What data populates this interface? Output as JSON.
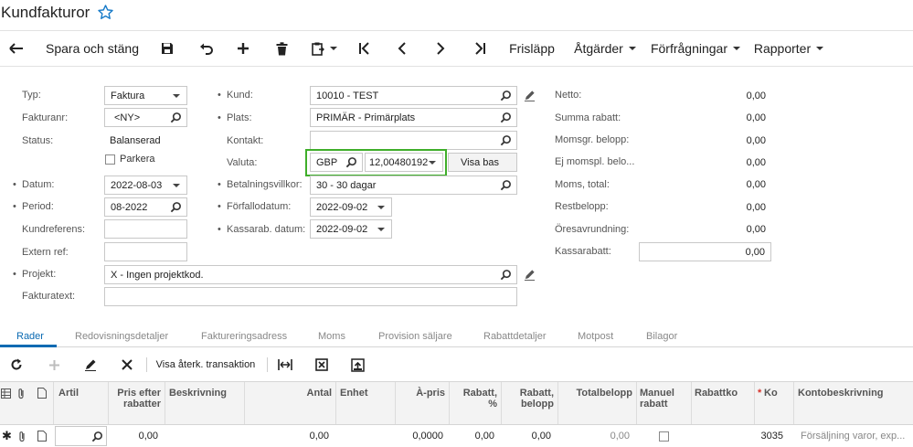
{
  "title": "Kundfakturor",
  "toolbar": {
    "save_close": "Spara och stäng",
    "release": "Frisläpp",
    "actions": "Åtgärder",
    "inquiries": "Förfrågningar",
    "reports": "Rapporter"
  },
  "form": {
    "type_label": "Typ:",
    "type_value": "Faktura",
    "invoice_no_label": "Fakturanr:",
    "invoice_no_value": "<NY>",
    "status_label": "Status:",
    "status_value": "Balanserad",
    "park_label": "Parkera",
    "date_label": "Datum:",
    "date_value": "2022-08-03",
    "period_label": "Period:",
    "period_value": "08-2022",
    "customer_ref_label": "Kundreferens:",
    "customer_ref_value": "",
    "external_ref_label": "Extern ref:",
    "external_ref_value": "",
    "project_label": "Projekt:",
    "project_value": "X - Ingen projektkod.",
    "invoice_text_label": "Fakturatext:",
    "invoice_text_value": "",
    "customer_label": "Kund:",
    "customer_value": "10010 - TEST",
    "location_label": "Plats:",
    "location_value": "PRIMÄR - Primärplats",
    "contact_label": "Kontakt:",
    "contact_value": "",
    "currency_label": "Valuta:",
    "currency_value": "GBP",
    "rate_value": "12,00480192",
    "show_base": "Visa bas",
    "terms_label": "Betalningsvillkor:",
    "terms_value": "30 - 30 dagar",
    "due_date_label": "Förfallodatum:",
    "due_date_value": "2022-09-02",
    "discount_date_label": "Kassarab. datum:",
    "discount_date_value": "2022-09-02"
  },
  "totals": {
    "net_label": "Netto:",
    "net_value": "0,00",
    "discount_sum_label": "Summa rabatt:",
    "discount_sum_value": "0,00",
    "taxable_label": "Momsgr. belopp:",
    "taxable_value": "0,00",
    "nontaxable_label": "Ej momspl. belo...",
    "nontaxable_value": "0,00",
    "tax_total_label": "Moms, total:",
    "tax_total_value": "0,00",
    "balance_label": "Restbelopp:",
    "balance_value": "0,00",
    "rounding_label": "Öresavrundning:",
    "rounding_value": "0,00",
    "cash_discount_label": "Kassarabatt:",
    "cash_discount_value": "0,00"
  },
  "tabs": [
    "Rader",
    "Redovisningsdetaljer",
    "Faktureringsadress",
    "Moms",
    "Provision säljare",
    "Rabattdetaljer",
    "Motpost",
    "Bilagor"
  ],
  "grid_toolbar": {
    "view_reversal": "Visa återk. transaktion"
  },
  "grid": {
    "headers": {
      "article": "Artil",
      "price_after_1": "Pris efter",
      "price_after_2": "rabatter",
      "description": "Beskrivning",
      "qty": "Antal",
      "unit": "Enhet",
      "unit_price": "À-pris",
      "disc_pct_1": "Rabatt,",
      "disc_pct_2": "%",
      "disc_amt_1": "Rabatt,",
      "disc_amt_2": "belopp",
      "total": "Totalbelopp",
      "manual_1": "Manuel",
      "manual_2": "rabatt",
      "disc_code": "Rabattko",
      "account": "Ko",
      "account_desc": "Kontobeskrivning"
    },
    "row": {
      "price_after": "0,00",
      "qty": "0,00",
      "unit_price": "0,0000",
      "disc_pct": "0,00",
      "disc_amt": "0,00",
      "total": "0,00",
      "account": "3035",
      "account_desc": "Försäljning varor, exp..."
    }
  },
  "colors": {
    "accent": "#0a6ab2",
    "highlight_border": "#3fae2a",
    "required_star": "#d6322a"
  }
}
